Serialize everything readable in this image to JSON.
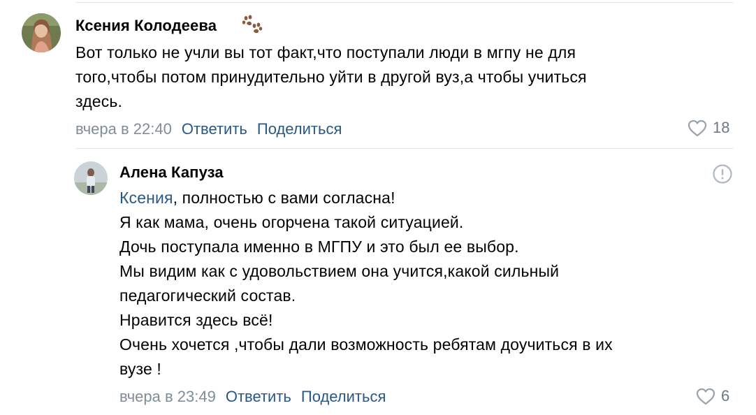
{
  "comments": [
    {
      "author": "Ксения Колодеева",
      "badge_icon": "paw-icon",
      "text_lines": [
        "Вот только не учли вы тот факт,что поступали люди в мгпу не для",
        "того,чтобы потом принудительно уйти в другой вуз,а чтобы учиться",
        "здесь."
      ],
      "timestamp": "вчера в 22:40",
      "reply_label": "Ответить",
      "share_label": "Поделиться",
      "likes": "18"
    },
    {
      "author": "Алена Капуза",
      "mention": "Ксения",
      "first_line_rest": ", полностью с вами согласна!",
      "text_lines": [
        "Я как мама, очень огорчена такой ситуацией.",
        "Дочь поступала именно в МГПУ и это был ее выбор.",
        "Мы видим как с удовольствием она учится,какой сильный",
        "педагогический состав.",
        "Нравится здесь всё!",
        "Очень хочется ,чтобы дали возможность ребятам доучиться в их",
        "вузе !"
      ],
      "timestamp": "вчера в 23:49",
      "reply_label": "Ответить",
      "share_label": "Поделиться",
      "likes": "6"
    }
  ],
  "colors": {
    "link": "#2a5885",
    "muted": "#818c99",
    "divider": "#e7e8ec",
    "like_icon": "#6d7885"
  }
}
